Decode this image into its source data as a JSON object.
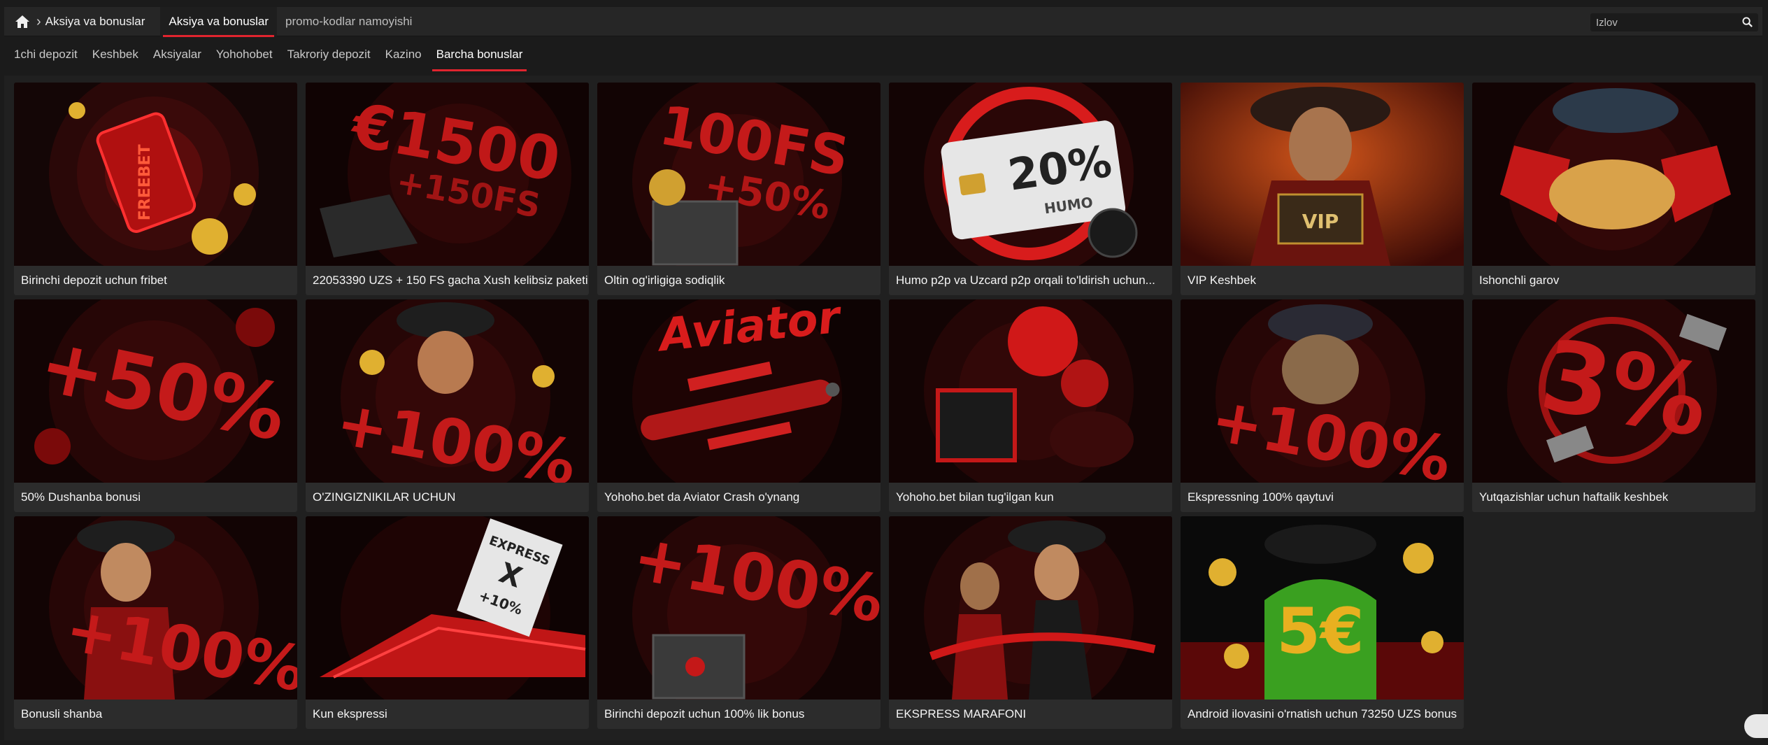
{
  "breadcrumb": {
    "home_icon": "home-icon",
    "separator_icon": "chevron-right-icon",
    "current": "Aksiya va bonuslar"
  },
  "top_tabs": [
    {
      "label": "Aksiya va bonuslar",
      "active": true
    },
    {
      "label": "promo-kodlar namoyishi",
      "active": false
    }
  ],
  "search": {
    "placeholder": "Izlov",
    "icon": "search-icon"
  },
  "sub_nav": [
    {
      "label": "1chi depozit",
      "active": false
    },
    {
      "label": "Keshbek",
      "active": false
    },
    {
      "label": "Aksiyalar",
      "active": false
    },
    {
      "label": "Yohohobet",
      "active": false
    },
    {
      "label": "Takroriy depozit",
      "active": false
    },
    {
      "label": "Kazino",
      "active": false
    },
    {
      "label": "Barcha bonuslar",
      "active": true
    }
  ],
  "cards": [
    {
      "title": "Birinchi depozit uchun fribet",
      "art_text": "FREEBET"
    },
    {
      "title": "22053390 UZS + 150 FS gacha Xush kelibsiz paketi",
      "art_text": "€1500",
      "art_text2": "+150FS"
    },
    {
      "title": "Oltin og'irligiga sodiqlik",
      "art_text": "100FS",
      "art_text2": "+50%"
    },
    {
      "title": "Humo p2p va Uzcard p2p orqali to'ldirish uchun...",
      "art_text": "20%",
      "art_text2": "HUMO"
    },
    {
      "title": "VIP Keshbek",
      "art_text": "VIP"
    },
    {
      "title": "Ishonchli garov",
      "art_text": ""
    },
    {
      "title": "50% Dushanba bonusi",
      "art_text": "+50%"
    },
    {
      "title": "O'ZINGIZNIKILAR UCHUN",
      "art_text": "+100%"
    },
    {
      "title": "Yohoho.bet da Aviator Crash o'ynang",
      "art_text": "Aviator"
    },
    {
      "title": "Yohoho.bet bilan tug'ilgan kun",
      "art_text": ""
    },
    {
      "title": "Ekspressning 100% qaytuvi",
      "art_text": "+100%"
    },
    {
      "title": "Yutqazishlar uchun haftalik keshbek",
      "art_text": "3%"
    },
    {
      "title": "Bonusli shanba",
      "art_text": "+100%"
    },
    {
      "title": "Kun ekspressi",
      "art_text": "EXPRESS",
      "art_text2": "+10%"
    },
    {
      "title": "Birinchi depozit uchun 100% lik bonus",
      "art_text": "+100%"
    },
    {
      "title": "EKSPRESS MARAFONI",
      "art_text": ""
    },
    {
      "title": "Android ilovasini o'rnatish uchun 73250 UZS bonus",
      "art_text": "5€"
    }
  ],
  "colors": {
    "accent": "#e0242e",
    "background": "#1b1b1b",
    "caption_bg": "#2c2c2c"
  }
}
